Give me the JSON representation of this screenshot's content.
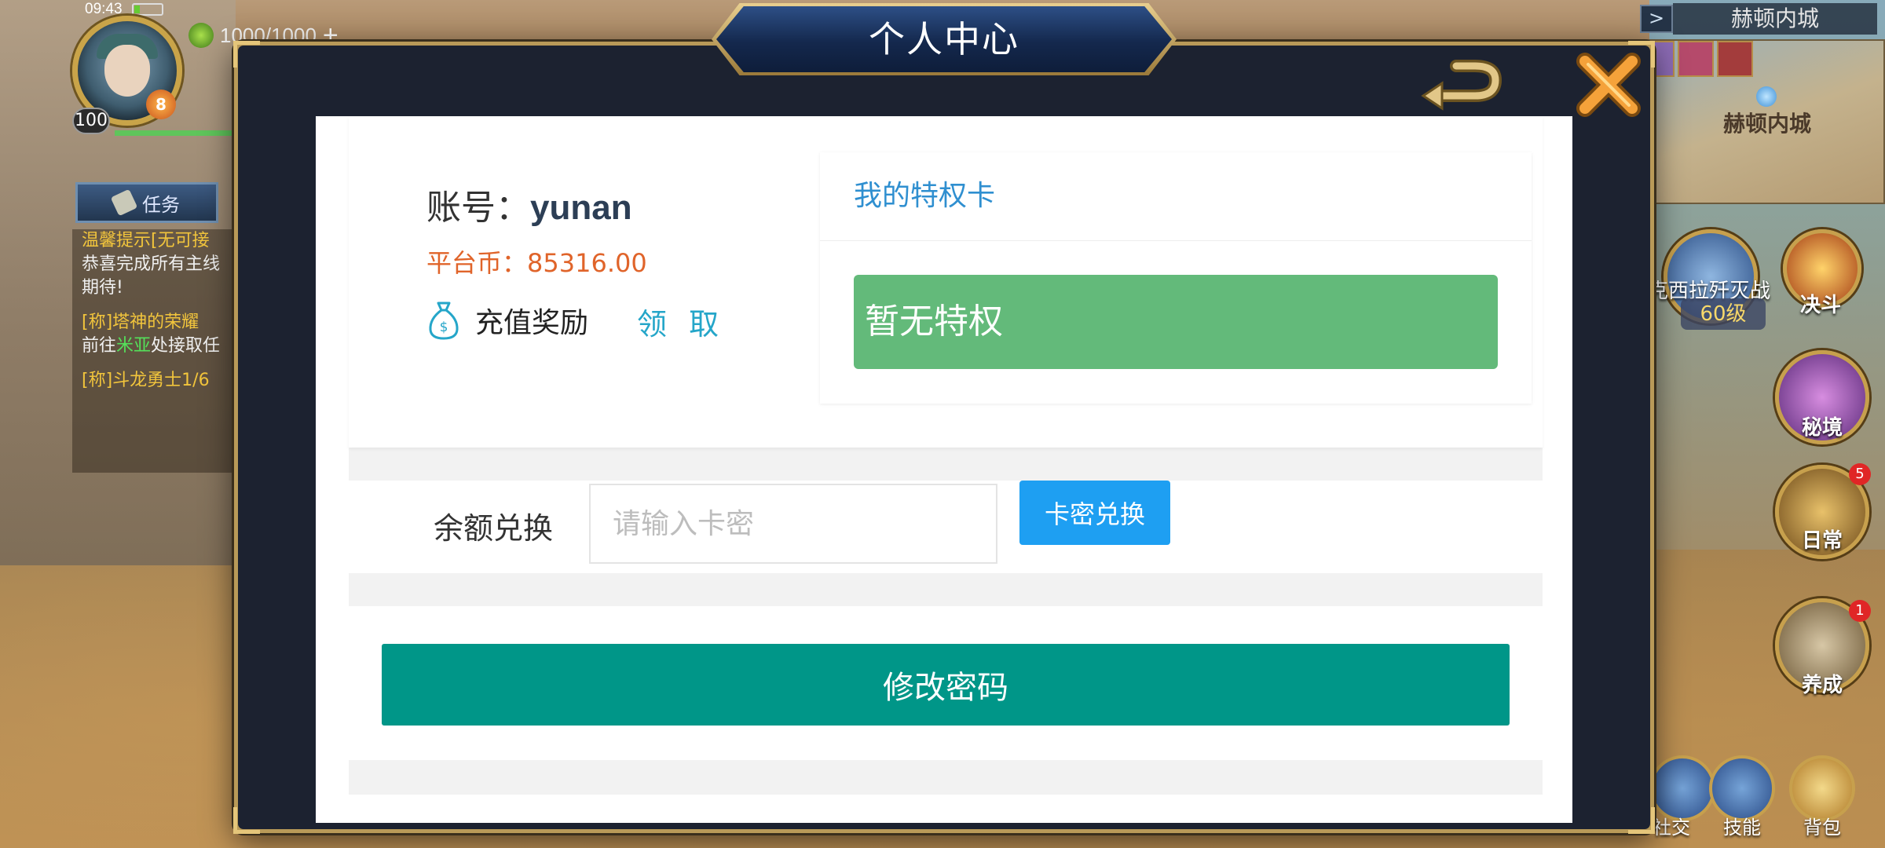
{
  "status_bar": {
    "time": "09:43",
    "battery_level": 0.2
  },
  "player": {
    "level": "100",
    "vip": "8",
    "energy": "1000/1000",
    "energy_plus": "+"
  },
  "quest_panel": {
    "tab_label": "任务",
    "lines": [
      {
        "text": "温馨提示[无可接",
        "style": "yellow"
      },
      {
        "text": "恭喜完成所有主线",
        "style": "white"
      },
      {
        "text": "期待!",
        "style": "white"
      },
      {
        "text": "[称]塔神的荣耀",
        "style": "yellow"
      },
      {
        "prefix": "前往",
        "highlight": "米亚",
        "suffix": "处接取任",
        "style": "white"
      },
      {
        "text": "[称]斗龙勇士1/6",
        "style": "yellow"
      }
    ]
  },
  "map": {
    "toggle": ">",
    "title": "赫顿内城",
    "location_label": "赫顿内城"
  },
  "side_menu": {
    "event_name": "克西拉歼灭战",
    "event_level": "60级",
    "duel": "决斗",
    "secret_realm": "秘境",
    "daily": "日常",
    "daily_badge": "5",
    "nurture": "养成",
    "nurture_badge": "1"
  },
  "bottom_bar": {
    "social": "社交",
    "skills": "技能",
    "backpack": "背包"
  },
  "modal": {
    "title": "个人中心",
    "back_icon": "back-arrow-icon",
    "close_icon": "close-x-icon",
    "account_label": "账号：",
    "account_value": "yunan",
    "coin_label": "平台币：",
    "coin_value": "85316.00",
    "reward_label": "充值奖励",
    "reward_icon": "money-bag-icon",
    "claim_label": "领 取",
    "privilege_header": "我的特权卡",
    "privilege_status": "暂无特权",
    "redeem_label": "余额兑换",
    "redeem_placeholder": "请输入卡密",
    "redeem_value": "",
    "redeem_button": "卡密兑换",
    "password_button": "修改密码"
  },
  "colors": {
    "accent_blue": "#1e9ff2",
    "teal_button": "#009688",
    "privilege_green": "#63ba7a",
    "coin_orange": "#e0642a",
    "link_blue": "#25a6c9"
  }
}
